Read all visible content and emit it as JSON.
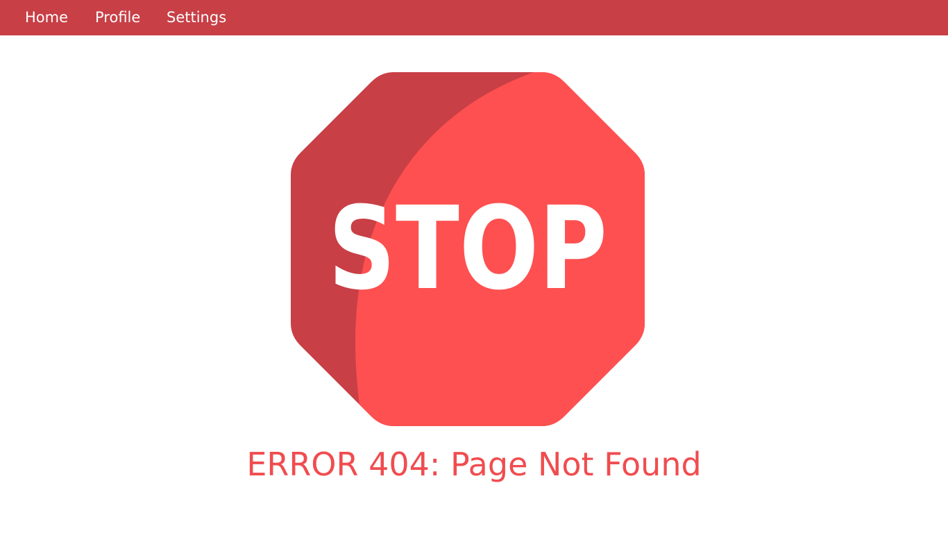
{
  "nav": {
    "items": [
      {
        "label": "Home"
      },
      {
        "label": "Profile"
      },
      {
        "label": "Settings"
      }
    ]
  },
  "error": {
    "sign_text": "STOP",
    "message": "ERROR 404: Page Not Found"
  },
  "colors": {
    "nav_background": "#c83f46",
    "sign_main": "#fe5050",
    "sign_shadow": "#c83f46",
    "sign_text": "#ffffff",
    "message_text": "#f04c4f"
  },
  "icons": {
    "sign": "stop-sign-icon"
  }
}
